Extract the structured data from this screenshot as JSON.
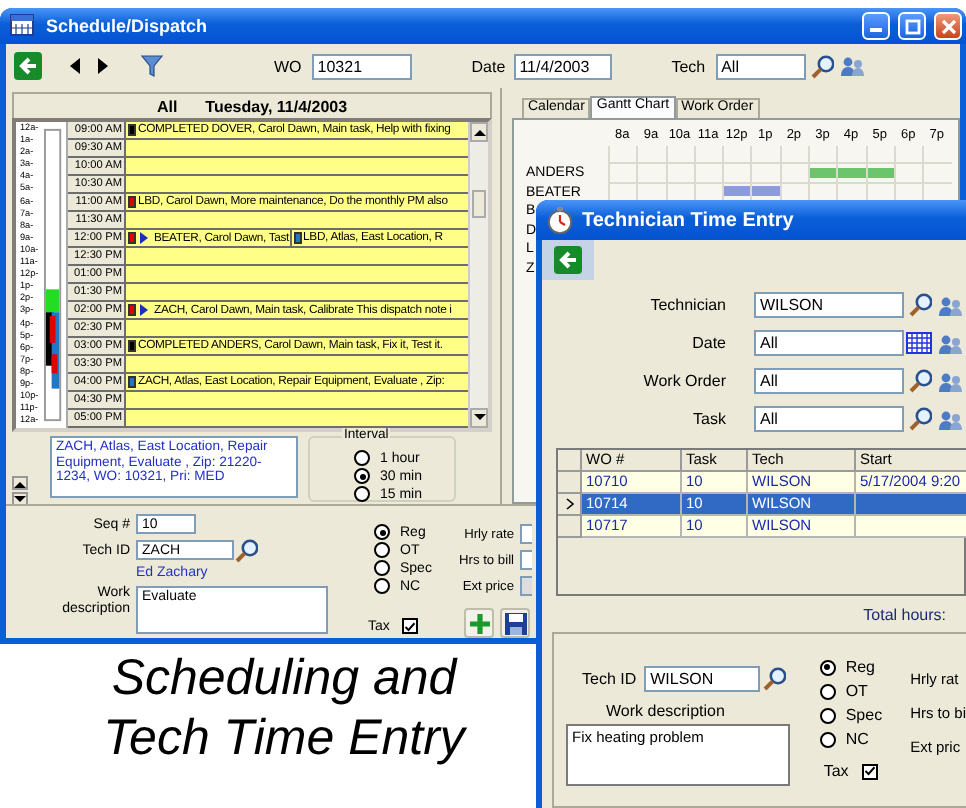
{
  "schedule_window": {
    "title": "Schedule/Dispatch",
    "toolbar": {
      "wo_label": "WO",
      "wo": "10321",
      "date_label": "Date",
      "date": "11/4/2003",
      "tech_label": "Tech",
      "tech": "All"
    },
    "calendar": {
      "filter": "All",
      "day": "Tuesday, 11/4/2003",
      "hour_labels": [
        "12a-",
        "1a-",
        "2a-",
        "3a-",
        "4a-",
        "5a-",
        "6a-",
        "7a-",
        "8a-",
        "9a-",
        "10a-",
        "11a-",
        "12p-",
        "1p-",
        "2p-",
        "3p-",
        "4p-",
        "5p-",
        "6p-",
        "7p-",
        "8p-",
        "9p-",
        "10p-",
        "11p-",
        "12a-"
      ],
      "slots": [
        {
          "time": "09:00 AM",
          "entries": [
            {
              "text": "COMPLETED DOVER, Carol Dawn, Main task, Help with fixing",
              "color": "#000000",
              "flagged": false
            }
          ]
        },
        {
          "time": "09:30 AM"
        },
        {
          "time": "10:00 AM"
        },
        {
          "time": "10:30 AM"
        },
        {
          "time": "11:00 AM",
          "entries": [
            {
              "text": "LBD, Carol Dawn, More maintenance, Do the monthly PM also",
              "color": "#e00000",
              "flagged": false
            }
          ]
        },
        {
          "time": "11:30 AM"
        },
        {
          "time": "12:00 PM",
          "entries": [
            {
              "text": "BEATER, Carol Dawn, Tast",
              "color": "#e00000",
              "flagged": true
            },
            {
              "text": "LBD,  Atlas, East Location, R",
              "color": "#1e78c8",
              "flagged": false
            }
          ]
        },
        {
          "time": "12:30 PM"
        },
        {
          "time": "01:00 PM"
        },
        {
          "time": "01:30 PM"
        },
        {
          "time": "02:00 PM",
          "entries": [
            {
              "text": "ZACH, Carol Dawn, Main task, Calibrate This dispatch note i",
              "color": "#e00000",
              "flagged": true
            }
          ]
        },
        {
          "time": "02:30 PM"
        },
        {
          "time": "03:00 PM",
          "entries": [
            {
              "text": "COMPLETED ANDERS, Carol Dawn, Main task, Fix it, Test it.",
              "color": "#000000",
              "flagged": false
            }
          ]
        },
        {
          "time": "03:30 PM"
        },
        {
          "time": "04:00 PM",
          "entries": [
            {
              "text": "ZACH,  Atlas, East Location, Repair Equipment, Evaluate , Zip:",
              "color": "#1e78c8",
              "flagged": false
            }
          ]
        },
        {
          "time": "04:30 PM"
        },
        {
          "time": "05:00 PM"
        }
      ]
    },
    "details": "ZACH,  Atlas, East Location, Repair Equipment, Evaluate , Zip: 21220-1234, WO: 10321, Pri: MED",
    "interval": {
      "label": "Interval",
      "options": [
        {
          "label": "1 hour",
          "selected": false
        },
        {
          "label": "30 min",
          "selected": true
        },
        {
          "label": "15 min",
          "selected": false
        }
      ]
    },
    "tabs": [
      {
        "label": "Calendar",
        "selected": false
      },
      {
        "label": "Gantt Chart",
        "selected": true
      },
      {
        "label": "Work Order",
        "selected": false
      }
    ],
    "gantt": {
      "hours": [
        "8a",
        "9a",
        "10a",
        "11a",
        "12p",
        "1p",
        "2p",
        "3p",
        "4p",
        "5p",
        "6p",
        "7p"
      ],
      "rows": [
        {
          "name": "ANDERS",
          "color": "#6cc46c",
          "busy": [
            false,
            false,
            false,
            false,
            false,
            false,
            false,
            true,
            true,
            true,
            false,
            false
          ]
        },
        {
          "name": "BEATER",
          "color": "#8c9be0",
          "busy": [
            false,
            false,
            false,
            false,
            true,
            true,
            false,
            false,
            false,
            false,
            false,
            false
          ]
        },
        {
          "name": "B"
        },
        {
          "name": "D"
        },
        {
          "name": "L"
        },
        {
          "name": "Z"
        }
      ]
    },
    "form": {
      "seq_label": "Seq #",
      "seq": "10",
      "tech_id_label": "Tech ID",
      "tech_id": "ZACH",
      "tech_name": "Ed Zachary",
      "work_label": "Work description",
      "work": "Evaluate",
      "rate_types": [
        {
          "label": "Reg",
          "selected": true
        },
        {
          "label": "OT",
          "selected": false
        },
        {
          "label": "Spec",
          "selected": false
        },
        {
          "label": "NC",
          "selected": false
        }
      ],
      "tax_label": "Tax",
      "tax": true,
      "hourly_rate_label": "Hrly rate",
      "hours_label": "Hrs to bill",
      "ext_price_label": "Ext price"
    }
  },
  "time_entry_window": {
    "title": "Technician Time Entry",
    "filters": [
      {
        "label": "Technician",
        "value": "WILSON",
        "kind": "search"
      },
      {
        "label": "Date",
        "value": "All",
        "kind": "date"
      },
      {
        "label": "Work Order",
        "value": "All",
        "kind": "search"
      },
      {
        "label": "Task",
        "value": "All",
        "kind": "search"
      }
    ],
    "table": {
      "columns": [
        "WO #",
        "Task",
        "Tech",
        "Start"
      ],
      "rows": [
        {
          "cells": [
            "10710",
            "10",
            "WILSON",
            "5/17/2004 9:20"
          ],
          "selected": false
        },
        {
          "cells": [
            "10714",
            "10",
            "WILSON"
          ],
          "selected": true
        },
        {
          "cells": [
            "10717",
            "10",
            "WILSON"
          ],
          "selected": false
        }
      ]
    },
    "total_label": "Total hours:",
    "form": {
      "tech_id_label": "Tech ID",
      "tech_id": "WILSON",
      "work_label": "Work description",
      "work": "Fix heating problem",
      "rate_types": [
        {
          "label": "Reg",
          "selected": true
        },
        {
          "label": "OT",
          "selected": false
        },
        {
          "label": "Spec",
          "selected": false
        },
        {
          "label": "NC",
          "selected": false
        }
      ],
      "tax_label": "Tax",
      "tax": true,
      "hourly_rate_label": "Hrly rat",
      "hours_label": "Hrs to bi",
      "ext_price_label": "Ext pric"
    }
  },
  "caption": [
    "Scheduling and",
    "Tech Time Entry"
  ]
}
